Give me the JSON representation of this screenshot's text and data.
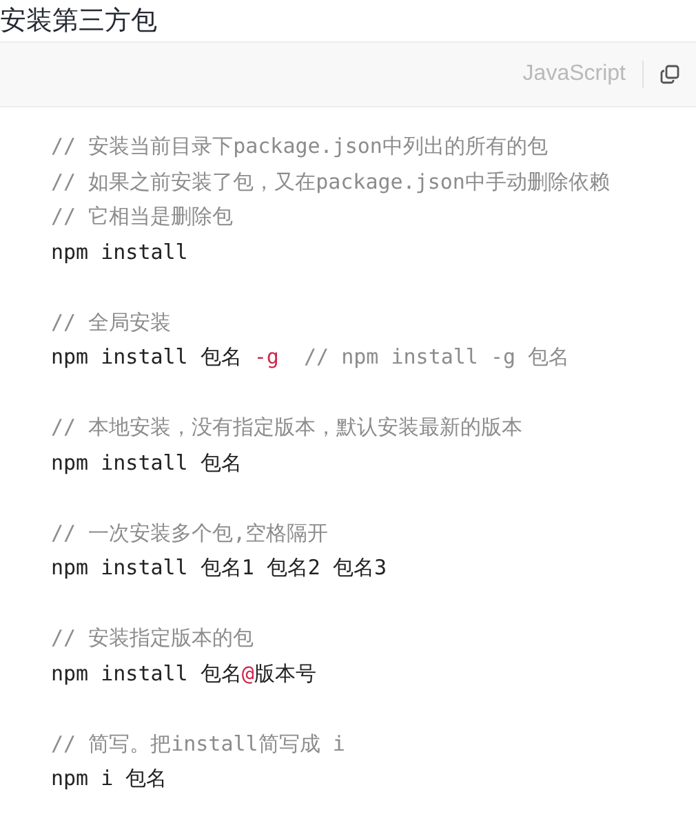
{
  "title": "安装第三方包",
  "code_block": {
    "language": "JavaScript",
    "lines": [
      {
        "kind": "code",
        "segments": [
          {
            "kind": "comment",
            "text": "// 安装当前目录下package.json中列出的所有的包"
          }
        ]
      },
      {
        "kind": "code",
        "segments": [
          {
            "kind": "comment",
            "text": "// 如果之前安装了包，又在package.json中手动删除依赖"
          }
        ]
      },
      {
        "kind": "code",
        "segments": [
          {
            "kind": "comment",
            "text": "// 它相当是删除包"
          }
        ]
      },
      {
        "kind": "code",
        "segments": [
          {
            "kind": "plain",
            "text": "npm install"
          }
        ]
      },
      {
        "kind": "blank"
      },
      {
        "kind": "code",
        "segments": [
          {
            "kind": "comment",
            "text": "// 全局安装"
          }
        ]
      },
      {
        "kind": "code",
        "segments": [
          {
            "kind": "plain",
            "text": "npm install 包名 "
          },
          {
            "kind": "operator",
            "text": "-g"
          },
          {
            "kind": "comment",
            "text": "  // npm install -g 包名"
          }
        ]
      },
      {
        "kind": "blank"
      },
      {
        "kind": "code",
        "segments": [
          {
            "kind": "comment",
            "text": "// 本地安装，没有指定版本，默认安装最新的版本"
          }
        ]
      },
      {
        "kind": "code",
        "segments": [
          {
            "kind": "plain",
            "text": "npm install 包名"
          }
        ]
      },
      {
        "kind": "blank"
      },
      {
        "kind": "code",
        "segments": [
          {
            "kind": "comment",
            "text": "// 一次安装多个包,空格隔开"
          }
        ]
      },
      {
        "kind": "code",
        "segments": [
          {
            "kind": "plain",
            "text": "npm install 包名1 包名2 包名3"
          }
        ]
      },
      {
        "kind": "blank"
      },
      {
        "kind": "code",
        "segments": [
          {
            "kind": "comment",
            "text": "// 安装指定版本的包"
          }
        ]
      },
      {
        "kind": "code",
        "segments": [
          {
            "kind": "plain",
            "text": "npm install 包名"
          },
          {
            "kind": "operator",
            "text": "@"
          },
          {
            "kind": "plain",
            "text": "版本号"
          }
        ]
      },
      {
        "kind": "blank"
      },
      {
        "kind": "code",
        "segments": [
          {
            "kind": "comment",
            "text": "// 简写。把install简写成 i"
          }
        ]
      },
      {
        "kind": "code",
        "segments": [
          {
            "kind": "plain",
            "text": "npm i 包名"
          }
        ]
      }
    ]
  }
}
